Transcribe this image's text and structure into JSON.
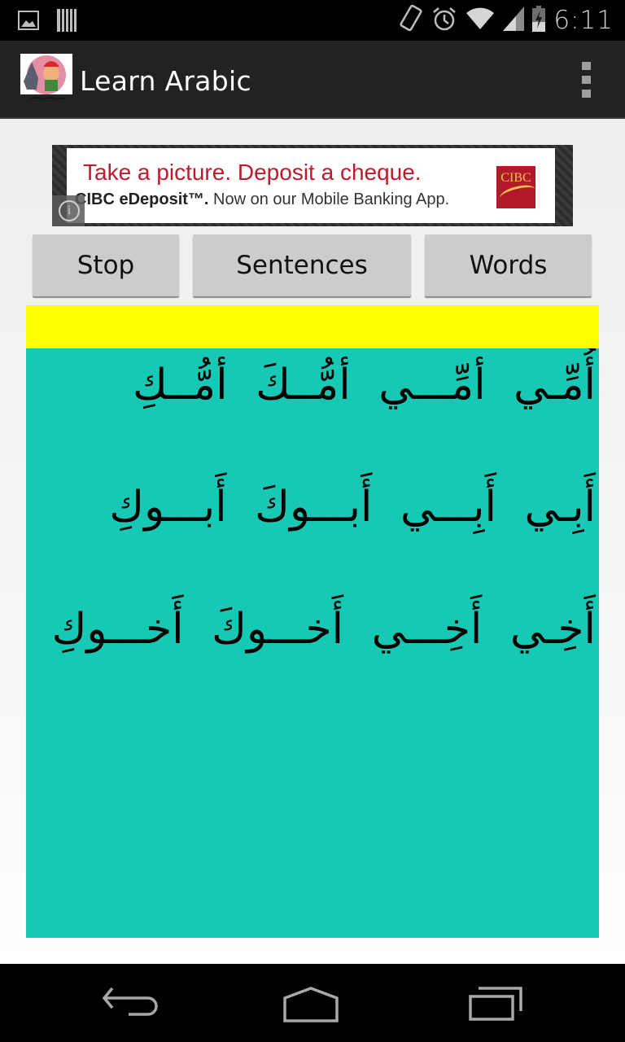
{
  "status_bar": {
    "left_icons": [
      "picture-notification-icon",
      "barcode-notification-icon"
    ],
    "right_icons": [
      "screen-rotation-icon",
      "alarm-icon",
      "wifi-icon",
      "cell-signal-icon",
      "battery-charging-icon"
    ],
    "time": "6:11"
  },
  "action_bar": {
    "title": "Learn Arabic",
    "app_icon": "learn-arabic-app-icon",
    "overflow_icon": "overflow-menu-icon"
  },
  "ad": {
    "headline": "Take a picture. Deposit a cheque.",
    "subline_brand": "CIBC eDeposit™.",
    "subline_rest": " Now on our Mobile Banking App.",
    "logo_text": "CIBC",
    "info_icon": "i",
    "colors": {
      "headline": "#c01a2c",
      "logo_bg": "#b3192a",
      "logo_text": "#f2c34a"
    }
  },
  "buttons": {
    "stop": "Stop",
    "sentences": "Sentences",
    "words": "Words"
  },
  "panel": {
    "highlight_color": "#ffff00",
    "background_color": "#17c9b5",
    "text": "أُمِّـي  أمِّـــي أمُّــكَ أمُّــكِ أَبِـي  أَبِـــي أَبـــوكَ أَبـــوكِ أَخِـي  أَخِـــي أَخـــوكَ أَخـــوكِ"
  },
  "nav_bar": {
    "back": "back-icon",
    "home": "home-icon",
    "recents": "recent-apps-icon"
  }
}
